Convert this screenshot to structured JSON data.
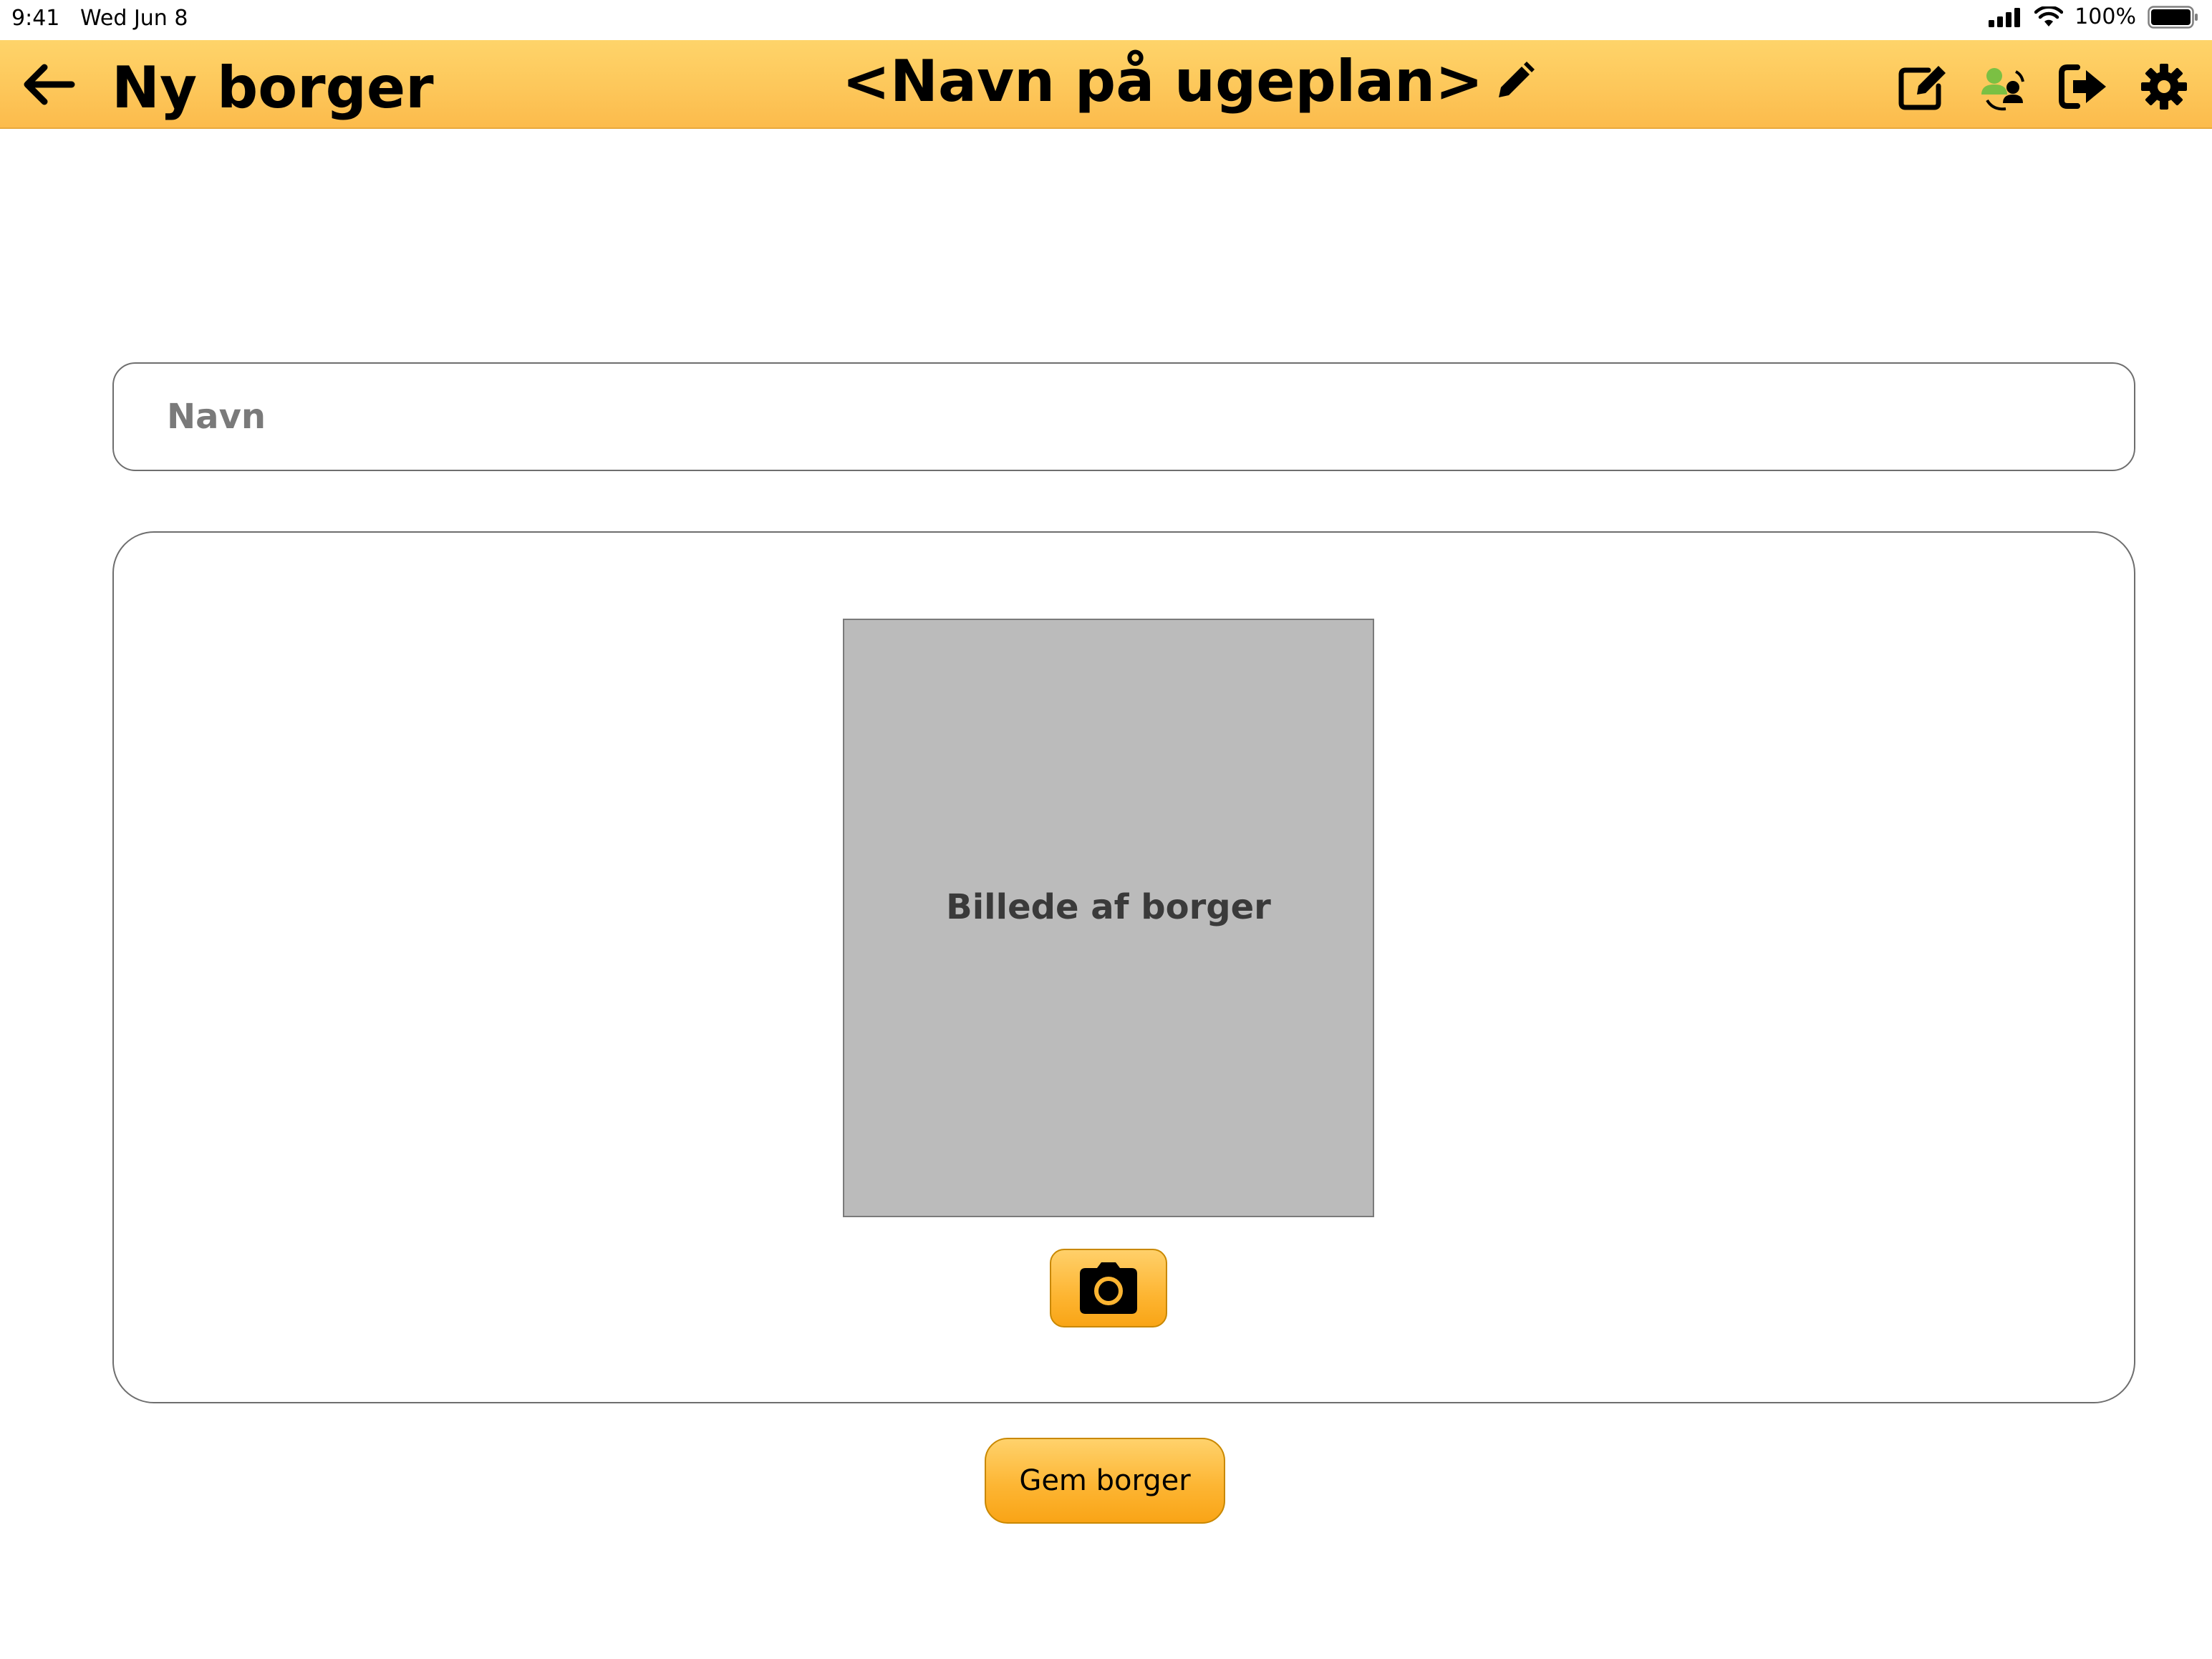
{
  "status_bar": {
    "time": "9:41",
    "date": "Wed Jun 8",
    "battery_percent": "100%",
    "icons": [
      "cellular-signal-icon",
      "wifi-icon",
      "battery-icon"
    ]
  },
  "header": {
    "back_icon": "arrow-left-icon",
    "title": "Ny borger",
    "center_title": "<Navn på ugeplan>",
    "center_edit_icon": "pencil-icon",
    "actions": [
      {
        "name": "edit-mode-icon"
      },
      {
        "name": "switch-citizen-icon"
      },
      {
        "name": "logout-icon"
      },
      {
        "name": "gear-icon"
      }
    ],
    "colors": {
      "bar_top": "#fed46a",
      "bar_bottom": "#fcbb4c",
      "switch_icon_green": "#7bc043"
    }
  },
  "form": {
    "name_placeholder": "Navn",
    "name_value": "",
    "picture_label": "Billede af borger",
    "camera_icon": "camera-icon",
    "save_label": "Gem borger"
  }
}
